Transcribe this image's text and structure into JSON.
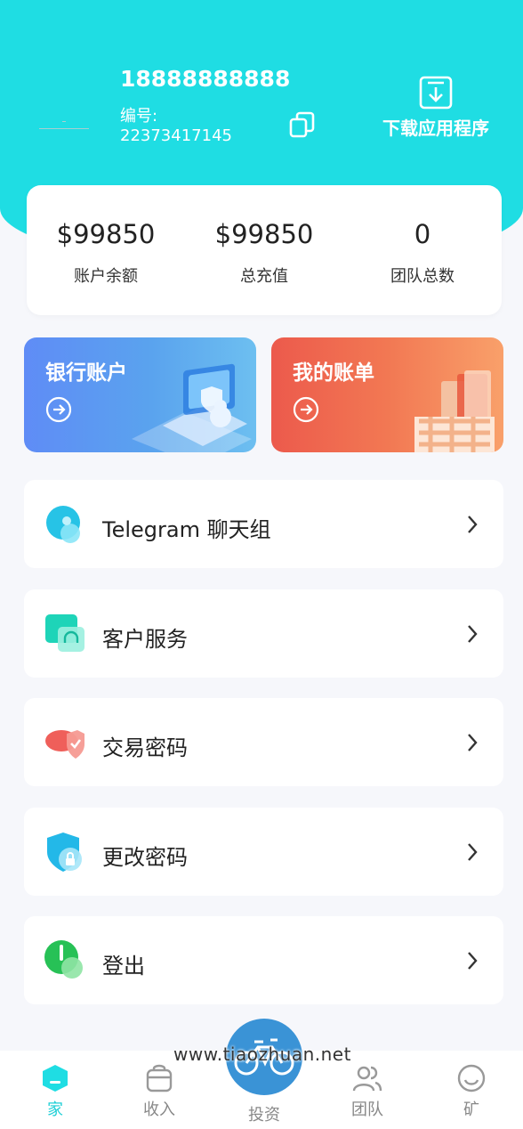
{
  "profile": {
    "phone": "18888888888",
    "id_label": "编号:",
    "id_value": "22373417145",
    "download_label": "下载应用程序"
  },
  "stats": [
    {
      "value": "$99850",
      "label": "账户余额"
    },
    {
      "value": "$99850",
      "label": "总充值"
    },
    {
      "value": "0",
      "label": "团队总数"
    }
  ],
  "cards": {
    "bank": {
      "title": "银行账户"
    },
    "bill": {
      "title": "我的账单"
    }
  },
  "menu": [
    {
      "label": "Telegram 聊天组",
      "icon": "chat-bubble-icon"
    },
    {
      "label": "客户服务",
      "icon": "headset-icon"
    },
    {
      "label": "交易密码",
      "icon": "shield-check-icon"
    },
    {
      "label": "更改密码",
      "icon": "shield-lock-icon"
    },
    {
      "label": "登出",
      "icon": "power-icon"
    }
  ],
  "tabbar": {
    "home": "家",
    "income": "收入",
    "invest": "投资",
    "team": "团队",
    "mine": "矿",
    "active": "home"
  },
  "watermark": "www.tiaozhuan.net",
  "colors": {
    "accent": "#1fdde3",
    "bank_card": "#5f8cf6",
    "bill_card": "#ec5a4c",
    "fab": "#3a93d6"
  }
}
